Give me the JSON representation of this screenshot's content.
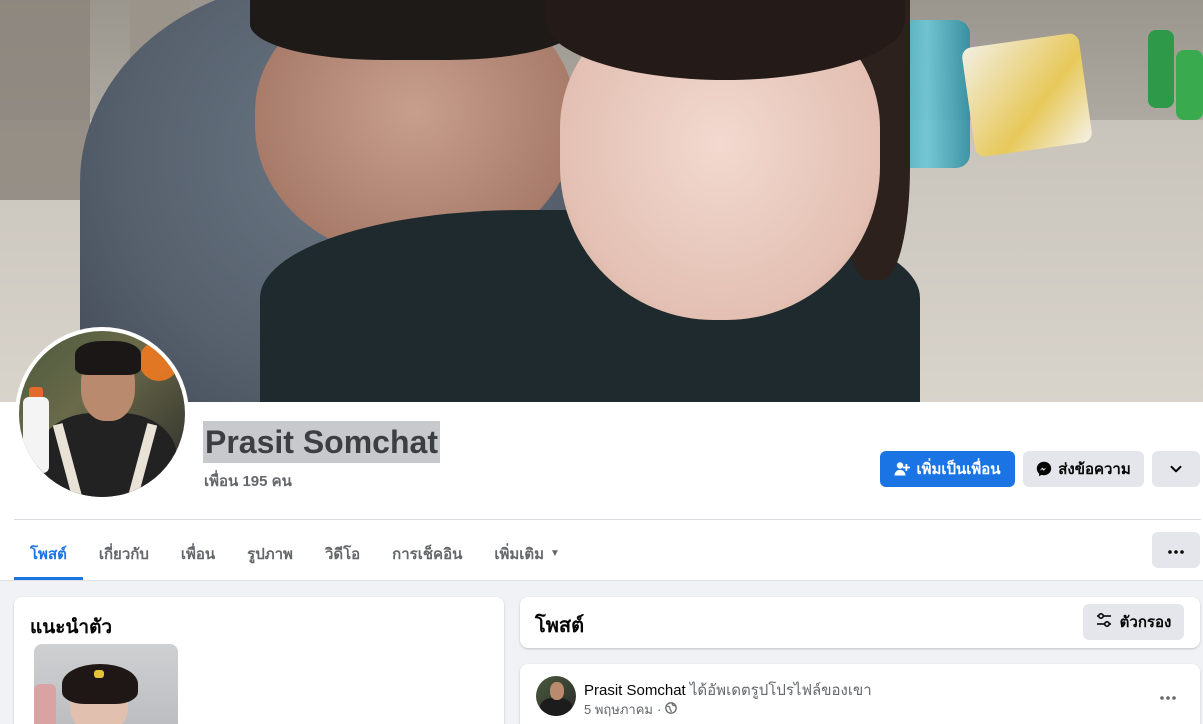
{
  "profile": {
    "name": "Prasit Somchat",
    "friends_text": "เพื่อน 195 คน"
  },
  "actions": {
    "add_friend_label": "เพิ่มเป็นเพื่อน",
    "message_label": "ส่งข้อความ",
    "more_icon": "chevron-down-icon",
    "primary_color": "#1b74e4"
  },
  "tabs": [
    {
      "label": "โพสต์",
      "active": true
    },
    {
      "label": "เกี่ยวกับ"
    },
    {
      "label": "เพื่อน"
    },
    {
      "label": "รูปภาพ"
    },
    {
      "label": "วิดีโอ"
    },
    {
      "label": "การเช็คอิน"
    },
    {
      "label": "เพิ่มเติม"
    }
  ],
  "intro": {
    "title": "แนะนำตัว"
  },
  "posts_section": {
    "title": "โพสต์",
    "filter_label": "ตัวกรอง"
  },
  "post": {
    "author": "Prasit Somchat",
    "action_text": "ได้อัพเดตรูปโปรไฟล์ของเขา",
    "date": "5 พฤษภาคม",
    "audience_icon": "globe-icon"
  }
}
